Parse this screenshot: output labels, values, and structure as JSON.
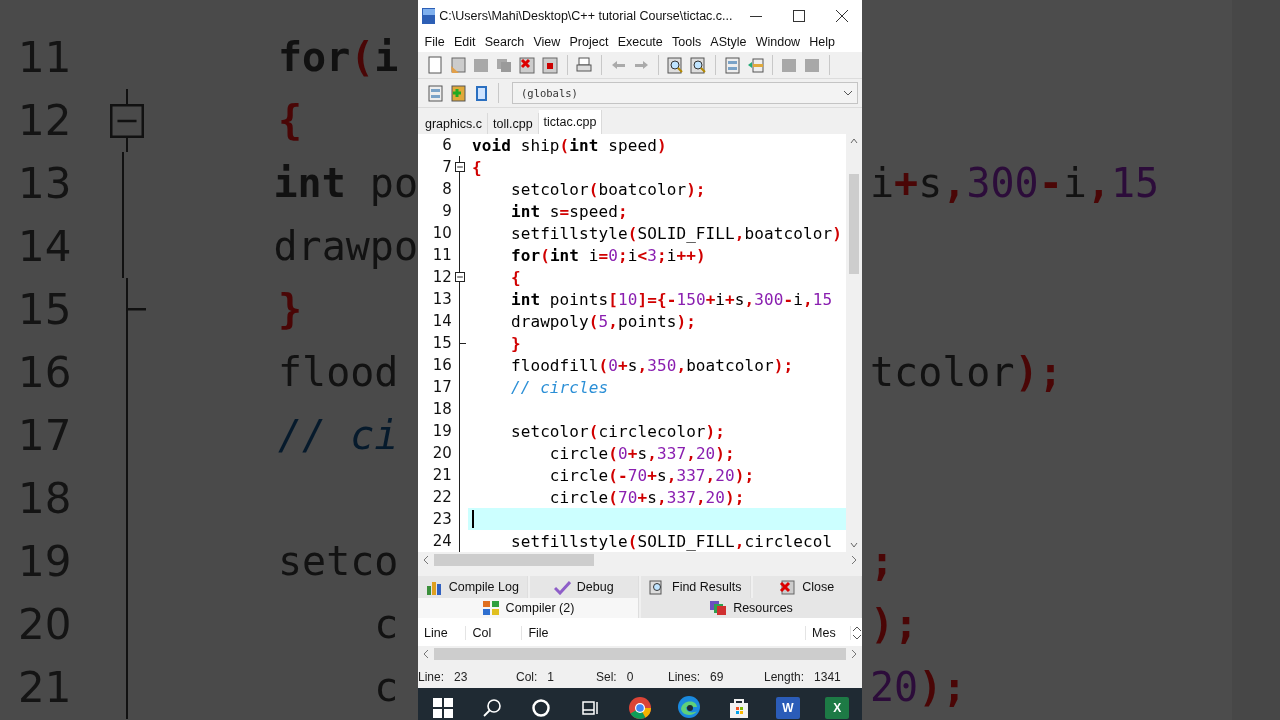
{
  "backdrop": {
    "rows": [
      {
        "number": "11",
        "fold_start": false,
        "fold_end": false,
        "tokens": [
          {
            "kind": "keyword",
            "text": "for"
          },
          {
            "kind": "punct",
            "text": "("
          },
          {
            "kind": "keyword",
            "text": "i"
          }
        ]
      },
      {
        "number": "12",
        "fold_start": true,
        "fold_end": false,
        "tokens": [
          {
            "kind": "punct",
            "text": "{"
          }
        ]
      },
      {
        "number": "13",
        "fold_start": false,
        "fold_end": false,
        "tokens": [
          {
            "kind": "keyword",
            "text": "int"
          },
          {
            "kind": "ident",
            "text": " po"
          }
        ],
        "tail": [
          {
            "kind": "ident",
            "text": "i"
          },
          {
            "kind": "punct",
            "text": "+"
          },
          {
            "kind": "ident",
            "text": "s"
          },
          {
            "kind": "punct",
            "text": ","
          },
          {
            "kind": "number",
            "text": "300"
          },
          {
            "kind": "punct",
            "text": "-"
          },
          {
            "kind": "ident",
            "text": "i"
          },
          {
            "kind": "punct",
            "text": ","
          },
          {
            "kind": "number",
            "text": "15"
          }
        ]
      },
      {
        "number": "14",
        "fold_start": false,
        "fold_end": false,
        "tokens": [
          {
            "kind": "ident",
            "text": "drawpo"
          }
        ]
      },
      {
        "number": "15",
        "fold_start": false,
        "fold_end": true,
        "tokens": [
          {
            "kind": "punct",
            "text": "}"
          }
        ]
      },
      {
        "number": "16",
        "fold_start": false,
        "fold_end": false,
        "tokens": [
          {
            "kind": "ident",
            "text": "flood"
          }
        ],
        "tail": [
          {
            "kind": "ident",
            "text": "tcolor"
          },
          {
            "kind": "punct",
            "text": ");"
          }
        ]
      },
      {
        "number": "17",
        "fold_start": false,
        "fold_end": false,
        "tokens": [
          {
            "kind": "comment",
            "text": "// ci"
          }
        ]
      },
      {
        "number": "18",
        "fold_start": false,
        "fold_end": false
      },
      {
        "number": "19",
        "fold_start": false,
        "fold_end": false,
        "tokens": [
          {
            "kind": "ident",
            "text": "setco"
          }
        ],
        "tail": [
          {
            "kind": "punct",
            "text": ";"
          }
        ]
      },
      {
        "number": "20",
        "fold_start": false,
        "fold_end": false,
        "tokens": [
          {
            "kind": "ident",
            "text": "    c"
          }
        ],
        "tail": [
          {
            "kind": "punct",
            "text": ");"
          }
        ]
      },
      {
        "number": "21",
        "fold_start": false,
        "fold_end": false,
        "tokens": [
          {
            "kind": "ident",
            "text": "    c"
          }
        ],
        "tail": [
          {
            "kind": "number",
            "text": "20"
          },
          {
            "kind": "punct",
            "text": ");"
          }
        ]
      }
    ]
  },
  "window": {
    "title": "C:\\Users\\Mahi\\Desktop\\C++ tutorial Course\\tictac.c..."
  },
  "menu": [
    "File",
    "Edit",
    "Search",
    "View",
    "Project",
    "Execute",
    "Tools",
    "AStyle",
    "Window",
    "Help"
  ],
  "scope_select": {
    "value": "(globals)"
  },
  "tabs": [
    {
      "label": "graphics.c",
      "selected": false
    },
    {
      "label": "toll.cpp",
      "selected": false
    },
    {
      "label": "tictac.cpp",
      "selected": true
    }
  ],
  "editor": {
    "lines": [
      {
        "number": "6",
        "fold_start": false,
        "fold_end": false,
        "current": false,
        "tokens": [
          {
            "kind": "keyword",
            "text": "void"
          },
          {
            "kind": "ident",
            "text": " ship"
          },
          {
            "kind": "punct",
            "text": "("
          },
          {
            "kind": "keyword",
            "text": "int"
          },
          {
            "kind": "ident",
            "text": " speed"
          },
          {
            "kind": "punct",
            "text": ")"
          }
        ]
      },
      {
        "number": "7",
        "fold_start": true,
        "fold_end": false,
        "current": false,
        "tokens": [
          {
            "kind": "punct",
            "text": "{"
          }
        ]
      },
      {
        "number": "8",
        "fold_start": false,
        "fold_end": false,
        "current": false,
        "tokens": [
          {
            "kind": "ident",
            "text": "    setcolor"
          },
          {
            "kind": "punct",
            "text": "("
          },
          {
            "kind": "ident",
            "text": "boatcolor"
          },
          {
            "kind": "punct",
            "text": ");"
          }
        ]
      },
      {
        "number": "9",
        "fold_start": false,
        "fold_end": false,
        "current": false,
        "tokens": [
          {
            "kind": "keyword",
            "text": "    int"
          },
          {
            "kind": "ident",
            "text": " s"
          },
          {
            "kind": "punct",
            "text": "="
          },
          {
            "kind": "ident",
            "text": "speed"
          },
          {
            "kind": "punct",
            "text": ";"
          }
        ]
      },
      {
        "number": "10",
        "fold_start": false,
        "fold_end": false,
        "current": false,
        "tokens": [
          {
            "kind": "ident",
            "text": "    setfillstyle"
          },
          {
            "kind": "punct",
            "text": "("
          },
          {
            "kind": "ident",
            "text": "SOLID_FILL"
          },
          {
            "kind": "punct",
            "text": ","
          },
          {
            "kind": "ident",
            "text": "boatcolor"
          },
          {
            "kind": "punct",
            "text": ")"
          }
        ]
      },
      {
        "number": "11",
        "fold_start": false,
        "fold_end": false,
        "current": false,
        "tokens": [
          {
            "kind": "keyword",
            "text": "    for"
          },
          {
            "kind": "punct",
            "text": "("
          },
          {
            "kind": "keyword",
            "text": "int"
          },
          {
            "kind": "ident",
            "text": " i"
          },
          {
            "kind": "punct",
            "text": "="
          },
          {
            "kind": "number",
            "text": "0"
          },
          {
            "kind": "punct",
            "text": ";"
          },
          {
            "kind": "ident",
            "text": "i"
          },
          {
            "kind": "punct",
            "text": "<"
          },
          {
            "kind": "number",
            "text": "3"
          },
          {
            "kind": "punct",
            "text": ";"
          },
          {
            "kind": "ident",
            "text": "i"
          },
          {
            "kind": "punct",
            "text": "++)"
          }
        ]
      },
      {
        "number": "12",
        "fold_start": true,
        "fold_end": false,
        "current": false,
        "tokens": [
          {
            "kind": "punct",
            "text": "    {"
          }
        ]
      },
      {
        "number": "13",
        "fold_start": false,
        "fold_end": false,
        "current": false,
        "tokens": [
          {
            "kind": "keyword",
            "text": "    int"
          },
          {
            "kind": "ident",
            "text": " points"
          },
          {
            "kind": "punct",
            "text": "["
          },
          {
            "kind": "number",
            "text": "10"
          },
          {
            "kind": "punct",
            "text": "]={-"
          },
          {
            "kind": "number",
            "text": "150"
          },
          {
            "kind": "punct",
            "text": "+"
          },
          {
            "kind": "ident",
            "text": "i"
          },
          {
            "kind": "punct",
            "text": "+"
          },
          {
            "kind": "ident",
            "text": "s"
          },
          {
            "kind": "punct",
            "text": ","
          },
          {
            "kind": "number",
            "text": "300"
          },
          {
            "kind": "punct",
            "text": "-"
          },
          {
            "kind": "ident",
            "text": "i"
          },
          {
            "kind": "punct",
            "text": ","
          },
          {
            "kind": "number",
            "text": "15"
          }
        ]
      },
      {
        "number": "14",
        "fold_start": false,
        "fold_end": false,
        "current": false,
        "tokens": [
          {
            "kind": "ident",
            "text": "    drawpoly"
          },
          {
            "kind": "punct",
            "text": "("
          },
          {
            "kind": "number",
            "text": "5"
          },
          {
            "kind": "punct",
            "text": ","
          },
          {
            "kind": "ident",
            "text": "points"
          },
          {
            "kind": "punct",
            "text": ");"
          }
        ]
      },
      {
        "number": "15",
        "fold_start": false,
        "fold_end": true,
        "current": false,
        "tokens": [
          {
            "kind": "punct",
            "text": "    }"
          }
        ]
      },
      {
        "number": "16",
        "fold_start": false,
        "fold_end": false,
        "current": false,
        "tokens": [
          {
            "kind": "ident",
            "text": "    floodfill"
          },
          {
            "kind": "punct",
            "text": "("
          },
          {
            "kind": "number",
            "text": "0"
          },
          {
            "kind": "punct",
            "text": "+"
          },
          {
            "kind": "ident",
            "text": "s"
          },
          {
            "kind": "punct",
            "text": ","
          },
          {
            "kind": "number",
            "text": "350"
          },
          {
            "kind": "punct",
            "text": ","
          },
          {
            "kind": "ident",
            "text": "boatcolor"
          },
          {
            "kind": "punct",
            "text": ");"
          }
        ]
      },
      {
        "number": "17",
        "fold_start": false,
        "fold_end": false,
        "current": false,
        "tokens": [
          {
            "kind": "comment",
            "text": "    // circles"
          }
        ]
      },
      {
        "number": "18",
        "fold_start": false,
        "fold_end": false,
        "current": false
      },
      {
        "number": "19",
        "fold_start": false,
        "fold_end": false,
        "current": false,
        "tokens": [
          {
            "kind": "ident",
            "text": "    setcolor"
          },
          {
            "kind": "punct",
            "text": "("
          },
          {
            "kind": "ident",
            "text": "circlecolor"
          },
          {
            "kind": "punct",
            "text": ");"
          }
        ]
      },
      {
        "number": "20",
        "fold_start": false,
        "fold_end": false,
        "current": false,
        "tokens": [
          {
            "kind": "ident",
            "text": "        circle"
          },
          {
            "kind": "punct",
            "text": "("
          },
          {
            "kind": "number",
            "text": "0"
          },
          {
            "kind": "punct",
            "text": "+"
          },
          {
            "kind": "ident",
            "text": "s"
          },
          {
            "kind": "punct",
            "text": ","
          },
          {
            "kind": "number",
            "text": "337"
          },
          {
            "kind": "punct",
            "text": ","
          },
          {
            "kind": "number",
            "text": "20"
          },
          {
            "kind": "punct",
            "text": ");"
          }
        ]
      },
      {
        "number": "21",
        "fold_start": false,
        "fold_end": false,
        "current": false,
        "tokens": [
          {
            "kind": "ident",
            "text": "        circle"
          },
          {
            "kind": "punct",
            "text": "(-"
          },
          {
            "kind": "number",
            "text": "70"
          },
          {
            "kind": "punct",
            "text": "+"
          },
          {
            "kind": "ident",
            "text": "s"
          },
          {
            "kind": "punct",
            "text": ","
          },
          {
            "kind": "number",
            "text": "337"
          },
          {
            "kind": "punct",
            "text": ","
          },
          {
            "kind": "number",
            "text": "20"
          },
          {
            "kind": "punct",
            "text": ");"
          }
        ]
      },
      {
        "number": "22",
        "fold_start": false,
        "fold_end": false,
        "current": false,
        "tokens": [
          {
            "kind": "ident",
            "text": "        circle"
          },
          {
            "kind": "punct",
            "text": "("
          },
          {
            "kind": "number",
            "text": "70"
          },
          {
            "kind": "punct",
            "text": "+"
          },
          {
            "kind": "ident",
            "text": "s"
          },
          {
            "kind": "punct",
            "text": ","
          },
          {
            "kind": "number",
            "text": "337"
          },
          {
            "kind": "punct",
            "text": ","
          },
          {
            "kind": "number",
            "text": "20"
          },
          {
            "kind": "punct",
            "text": ");"
          }
        ]
      },
      {
        "number": "23",
        "fold_start": false,
        "fold_end": false,
        "current": true
      },
      {
        "number": "24",
        "fold_start": false,
        "fold_end": false,
        "current": false,
        "tokens": [
          {
            "kind": "ident",
            "text": "    setfillstyle"
          },
          {
            "kind": "punct",
            "text": "("
          },
          {
            "kind": "ident",
            "text": "SOLID_FILL"
          },
          {
            "kind": "punct",
            "text": ","
          },
          {
            "kind": "ident",
            "text": "circlecol"
          }
        ]
      }
    ]
  },
  "bottom_tabs": [
    {
      "tabs": [
        {
          "kind": "log",
          "label": "Compile Log",
          "selected": false
        },
        {
          "kind": "debug",
          "label": "Debug",
          "selected": false
        },
        {
          "kind": "find",
          "label": "Find Results",
          "selected": false
        },
        {
          "kind": "close",
          "label": "Close",
          "selected": false
        }
      ]
    },
    {
      "tabs": [
        {
          "kind": "compiler",
          "label": "Compiler (2)",
          "selected": true
        },
        {
          "kind": "resources",
          "label": "Resources",
          "selected": false
        }
      ]
    }
  ],
  "messages": {
    "columns": [
      "Line",
      "Col",
      "File",
      "Mes"
    ]
  },
  "status": [
    {
      "label": "Line:",
      "value": "23"
    },
    {
      "label": "Col:",
      "value": "1"
    },
    {
      "label": "Sel:",
      "value": "0"
    },
    {
      "label": "Lines:",
      "value": "69"
    },
    {
      "label": "Length:",
      "value": "1341"
    }
  ],
  "taskbar": [
    {
      "kind": "start",
      "active": false
    },
    {
      "kind": "search",
      "active": false
    },
    {
      "kind": "cortana",
      "active": false
    },
    {
      "kind": "taskview",
      "active": false
    },
    {
      "kind": "chrome",
      "active": false
    },
    {
      "kind": "edge",
      "active": true
    },
    {
      "kind": "store",
      "active": false
    },
    {
      "kind": "word",
      "label": "W",
      "active": false
    },
    {
      "kind": "excel",
      "label": "X",
      "active": false
    }
  ]
}
